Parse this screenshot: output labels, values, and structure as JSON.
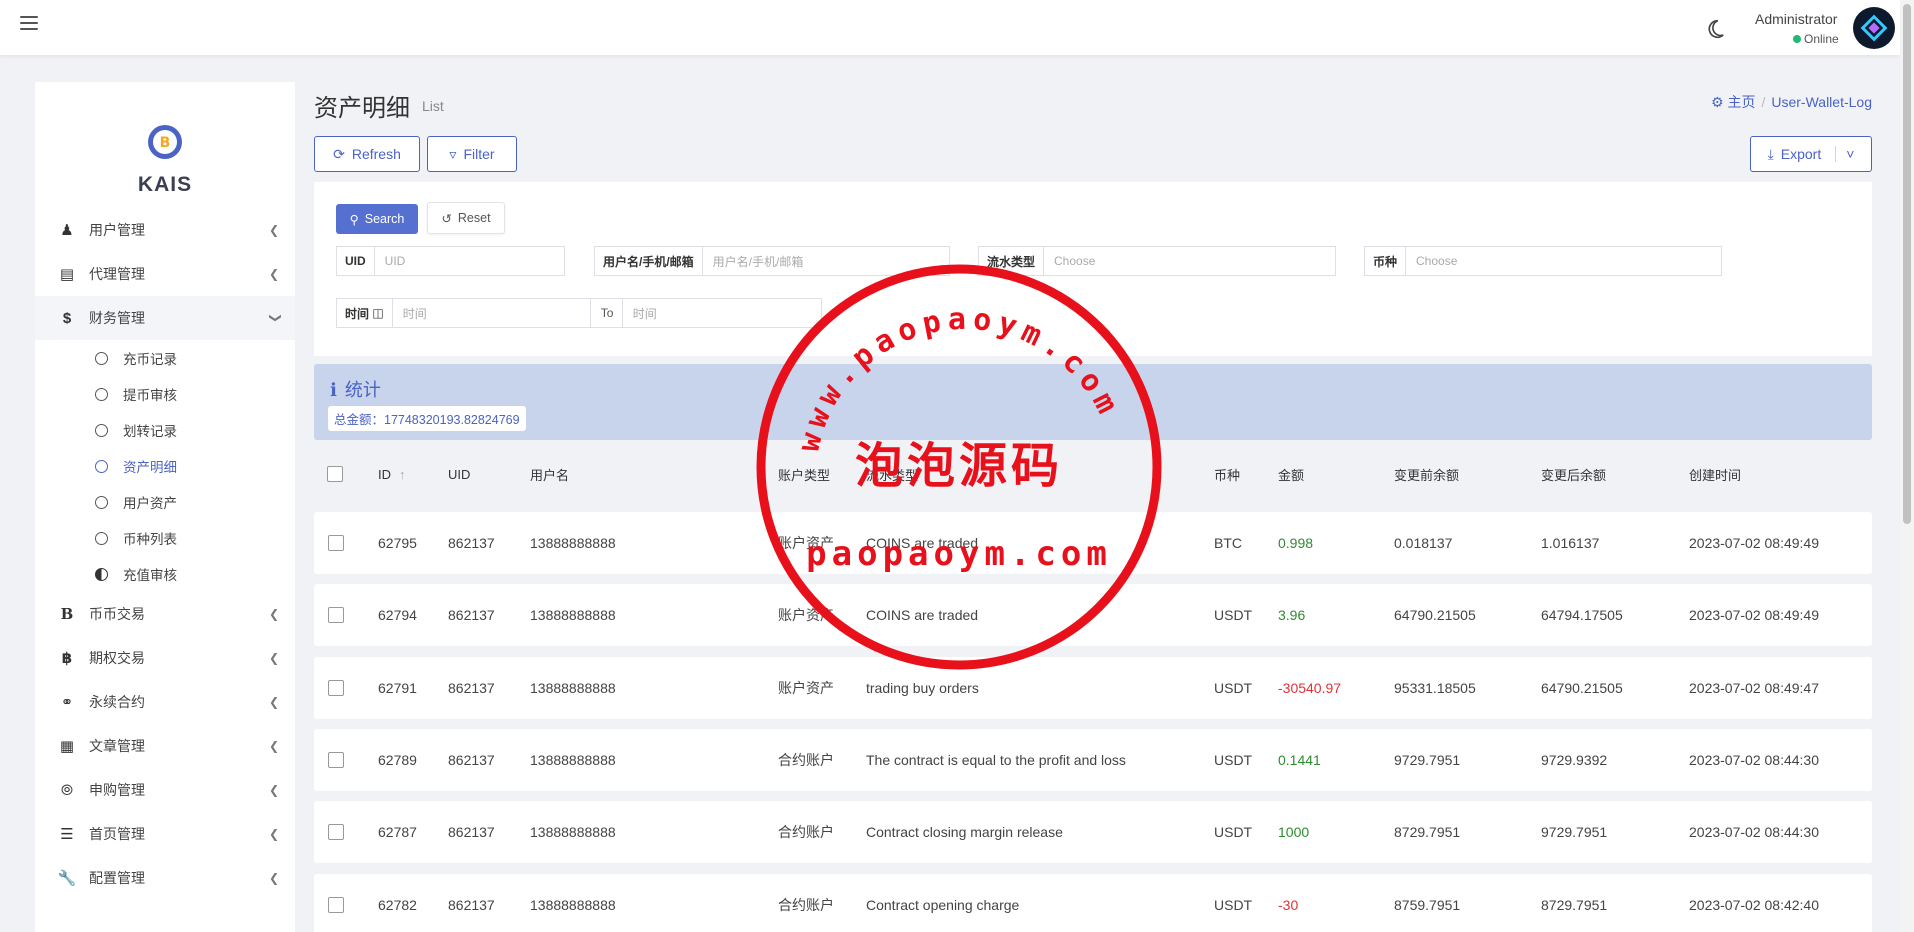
{
  "topbar": {
    "user_name": "Administrator",
    "user_status": "Online"
  },
  "sidebar": {
    "brand": "KAIS",
    "menu": [
      {
        "label": "用户管理",
        "icon": "user-tie-icon"
      },
      {
        "label": "代理管理",
        "icon": "id-card-icon"
      },
      {
        "label": "财务管理",
        "icon": "dollar-icon"
      },
      {
        "label": "币币交易",
        "icon": "bitcoin-b-icon"
      },
      {
        "label": "期权交易",
        "icon": "bitcoin-icon"
      },
      {
        "label": "永续合约",
        "icon": "link-icon"
      },
      {
        "label": "文章管理",
        "icon": "newspaper-icon"
      },
      {
        "label": "申购管理",
        "icon": "life-ring-icon"
      },
      {
        "label": "首页管理",
        "icon": "bars-icon"
      },
      {
        "label": "配置管理",
        "icon": "wrench-icon"
      }
    ],
    "submenu": [
      {
        "label": "充币记录"
      },
      {
        "label": "提币审核"
      },
      {
        "label": "划转记录"
      },
      {
        "label": "资产明细"
      },
      {
        "label": "用户资产"
      },
      {
        "label": "币种列表"
      },
      {
        "label": "充值审核"
      }
    ]
  },
  "page": {
    "title": "资产明细",
    "subtitle": "List",
    "breadcrumb_home": "主页",
    "breadcrumb_current": "User-Wallet-Log"
  },
  "toolbar": {
    "refresh": "Refresh",
    "filter": "Filter",
    "export": "Export"
  },
  "filter": {
    "search": "Search",
    "reset": "Reset",
    "uid_label": "UID",
    "uid_placeholder": "UID",
    "user_label": "用户名/手机/邮箱",
    "user_placeholder": "用户名/手机/邮箱",
    "flow_label": "流水类型",
    "flow_placeholder": "Choose",
    "coin_label": "币种",
    "coin_placeholder": "Choose",
    "time_label": "时间",
    "time_start": "时间",
    "time_to": "To",
    "time_end": "时间"
  },
  "stats": {
    "title": "统计",
    "total": "总金额：17748320193.82824769"
  },
  "table": {
    "columns": [
      "ID",
      "UID",
      "用户名",
      "账户类型",
      "流水类型",
      "币种",
      "金额",
      "变更前余额",
      "变更后余额",
      "创建时间"
    ],
    "rows": [
      {
        "id": "62795",
        "uid": "862137",
        "username": "13888888888",
        "account": "账户资产",
        "flow": "COINS are traded",
        "coin": "BTC",
        "amount": "0.998",
        "sign": "pos",
        "before": "0.018137",
        "after": "1.016137",
        "time": "2023-07-02 08:49:49"
      },
      {
        "id": "62794",
        "uid": "862137",
        "username": "13888888888",
        "account": "账户资产",
        "flow": "COINS are traded",
        "coin": "USDT",
        "amount": "3.96",
        "sign": "pos",
        "before": "64790.21505",
        "after": "64794.17505",
        "time": "2023-07-02 08:49:49"
      },
      {
        "id": "62791",
        "uid": "862137",
        "username": "13888888888",
        "account": "账户资产",
        "flow": "trading buy orders",
        "coin": "USDT",
        "amount": "-30540.97",
        "sign": "neg",
        "before": "95331.18505",
        "after": "64790.21505",
        "time": "2023-07-02 08:49:47"
      },
      {
        "id": "62789",
        "uid": "862137",
        "username": "13888888888",
        "account": "合约账户",
        "flow": "The contract is equal to the profit and loss",
        "coin": "USDT",
        "amount": "0.1441",
        "sign": "pos",
        "before": "9729.7951",
        "after": "9729.9392",
        "time": "2023-07-02 08:44:30"
      },
      {
        "id": "62787",
        "uid": "862137",
        "username": "13888888888",
        "account": "合约账户",
        "flow": "Contract closing margin release",
        "coin": "USDT",
        "amount": "1000",
        "sign": "pos",
        "before": "8729.7951",
        "after": "9729.7951",
        "time": "2023-07-02 08:44:30"
      },
      {
        "id": "62782",
        "uid": "862137",
        "username": "13888888888",
        "account": "合约账户",
        "flow": "Contract opening charge",
        "coin": "USDT",
        "amount": "-30",
        "sign": "neg",
        "before": "8759.7951",
        "after": "8729.7951",
        "time": "2023-07-02 08:42:40"
      }
    ]
  },
  "watermark": {
    "url_arc": "www.paopaoym.com",
    "cn": "泡泡源码",
    "domain": "paopaoym.com"
  },
  "colors": {
    "accent": "#4a63c5",
    "positive": "#2e8b2e",
    "negative": "#e0323a",
    "stamp": "#e8101a"
  }
}
